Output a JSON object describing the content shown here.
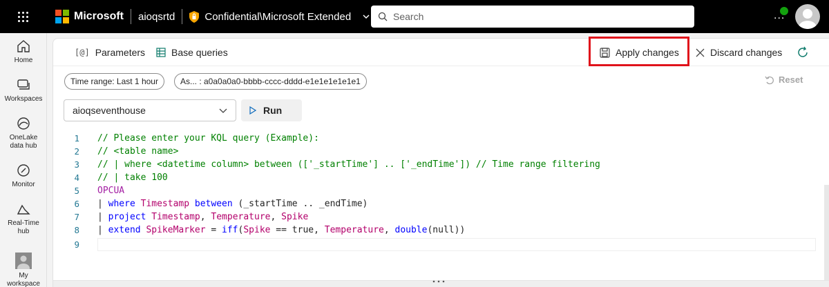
{
  "topbar": {
    "brand": "Microsoft",
    "workspace": "aioqsrtd",
    "sensitivity_label": "Confidential\\Microsoft Extended",
    "search_placeholder": "Search",
    "more_label": "..."
  },
  "rail": [
    {
      "label": "Home",
      "icon": "home-icon"
    },
    {
      "label": "Workspaces",
      "icon": "workspaces-icon"
    },
    {
      "label": "OneLake data hub",
      "icon": "onelake-icon"
    },
    {
      "label": "Monitor",
      "icon": "monitor-icon"
    },
    {
      "label": "Real-Time hub",
      "icon": "realtime-hub-icon"
    },
    {
      "label": "My workspace",
      "icon": "avatar"
    }
  ],
  "toolbar": {
    "parameters": "Parameters",
    "base_queries": "Base queries",
    "apply": "Apply changes",
    "discard": "Discard changes"
  },
  "filters": {
    "time_range": "Time range: Last 1 hour",
    "as_param": "As... : a0a0a0a0-bbbb-cccc-dddd-e1e1e1e1e1e1",
    "reset": "Reset"
  },
  "query": {
    "database": "aioqseventhouse",
    "run": "Run"
  },
  "editor": {
    "line_numbers": [
      "1",
      "2",
      "3",
      "4",
      "5",
      "6",
      "7",
      "8",
      "9"
    ],
    "line1": "// Please enter your KQL query (Example):",
    "line2": "// <table name>",
    "line3": "// | where <datetime column> between (['_startTime'] .. ['_endTime']) // Time range filtering",
    "line4": "// | take 100",
    "l5_table": "OPCUA",
    "l6_pipe": "| ",
    "l6_where": "where",
    "l6_ts": "Timestamp",
    "l6_between": "between",
    "l6_rest": " (_startTime .. _endTime)",
    "l7_pipe": "| ",
    "l7_project": "project",
    "l7_ts": "Timestamp",
    "l7_comma1": ", ",
    "l7_temp": "Temperature",
    "l7_comma2": ", ",
    "l7_spike": "Spike",
    "l8_pipe": "| ",
    "l8_extend": "extend",
    "l8_marker": "SpikeMarker",
    "l8_eq": " = ",
    "l8_iff": "iff",
    "l8_open": "(",
    "l8_spike": "Spike",
    "l8_cmp": " == true, ",
    "l8_temp": "Temperature",
    "l8_c": ", ",
    "l8_double": "double",
    "l8_end": "(null))"
  },
  "colors": {
    "highlight_border": "#e0121b",
    "status_online": "#13a10e",
    "comment": "#008000",
    "keyword": "#a31fa3",
    "function": "#0000ff"
  }
}
